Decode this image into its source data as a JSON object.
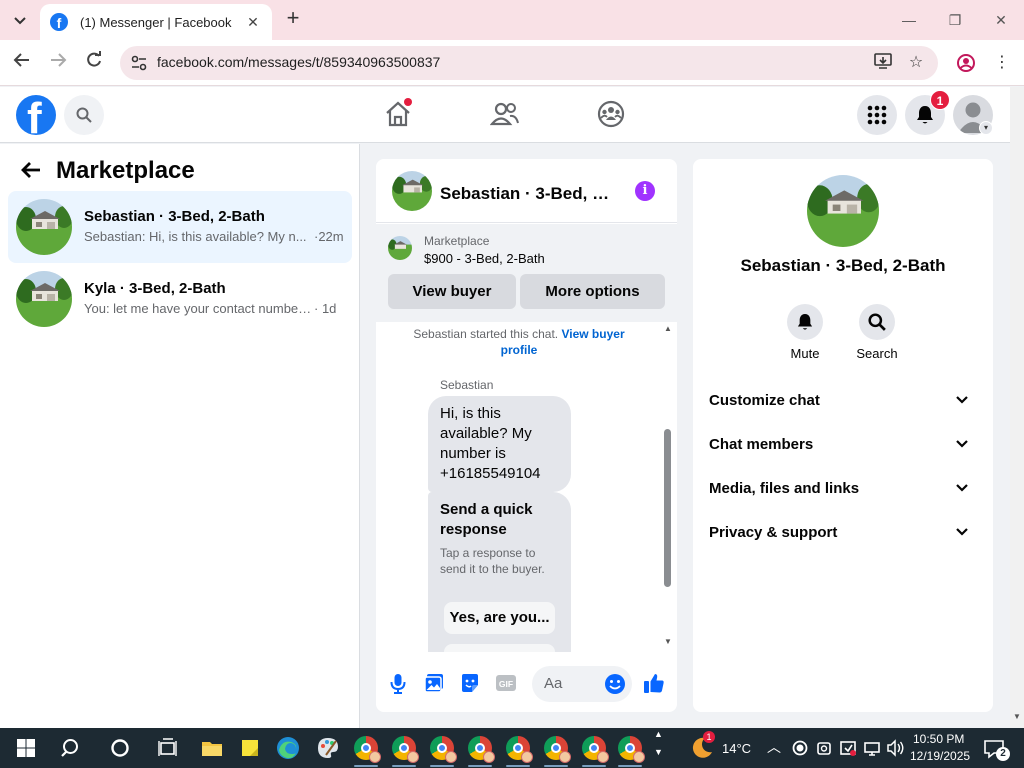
{
  "browser": {
    "tab_title": "(1) Messenger | Facebook",
    "url": "facebook.com/messages/t/859340963500837"
  },
  "facebook": {
    "notification_count": "1"
  },
  "sidebar": {
    "title": "Marketplace",
    "conversations": [
      {
        "name": "Sebastian · 3-Bed, 2-Bath",
        "preview": "Sebastian: Hi, is this available? My n...",
        "time": "·22m"
      },
      {
        "name": "Kyla · 3-Bed, 2-Bath",
        "preview": "You: let me have your contact number...",
        "time": "· 1d"
      }
    ]
  },
  "chat": {
    "title": "Sebastian · 3-Bed, 2-...",
    "listing_label": "Marketplace",
    "listing_price": "$900 - 3-Bed, 2-Bath",
    "view_buyer_label": "View buyer",
    "more_options_label": "More options",
    "started_text": "Sebastian started this chat.",
    "view_profile_link": "View buyer profile",
    "sender": "Sebastian",
    "message": "Hi, is this available? My number is +16185549104",
    "quick_response_title": "Send a quick response",
    "quick_response_sub": "Tap a response to send it to the buyer.",
    "quick_option_1": "Yes, are you...",
    "input_placeholder": "Aa"
  },
  "details": {
    "name": "Sebastian · 3-Bed, 2-Bath",
    "actions": [
      {
        "label": "Mute",
        "icon": "bell-icon"
      },
      {
        "label": "Search",
        "icon": "search-icon"
      }
    ],
    "sections": [
      "Customize chat",
      "Chat members",
      "Media, files and links",
      "Privacy & support"
    ]
  },
  "taskbar": {
    "weather_badge": "1",
    "temperature": "14°C",
    "time": "10:50 PM",
    "date": "12/19/2025",
    "notification_count": "2"
  },
  "colors": {
    "facebook_blue": "#1877f2",
    "messenger_purple": "#a033ff",
    "badge_red": "#e41e3f",
    "active_conversation": "#ebf5ff"
  }
}
